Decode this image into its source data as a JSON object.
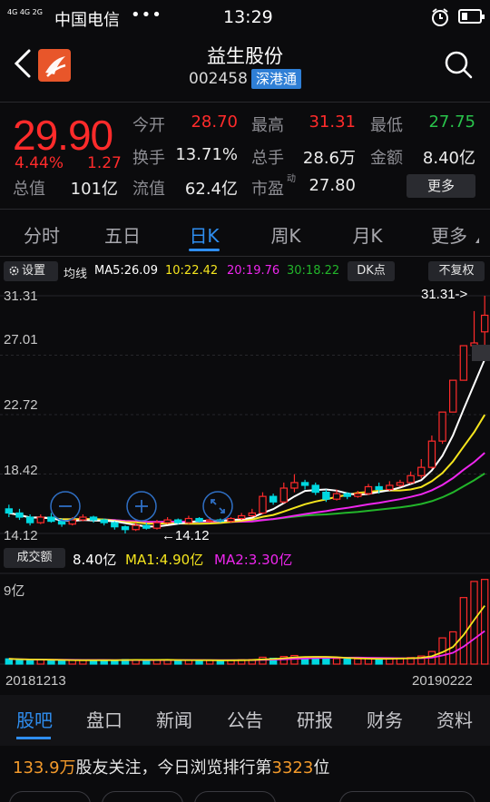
{
  "status": {
    "network": "4G 4G 2G",
    "carrier": "中国电信",
    "dots": "•••",
    "time": "13:29"
  },
  "header": {
    "title": "益生股份",
    "code": "002458",
    "tag": "深港通"
  },
  "quote": {
    "price": "29.90",
    "change_pct": "4.44%",
    "change": "1.27",
    "open_label": "今开",
    "open": "28.70",
    "high_label": "最高",
    "high": "31.31",
    "low_label": "最低",
    "low": "27.75",
    "turnover_label": "换手",
    "turnover": "13.71%",
    "volume_label": "总手",
    "volume": "28.6万",
    "amount_label": "金额",
    "amount": "8.40亿",
    "total_cap_label": "总值",
    "total_cap": "101亿",
    "float_cap_label": "流值",
    "float_cap": "62.4亿",
    "pe_label": "市盈",
    "pe_sup": "动",
    "pe": "27.80",
    "more_label": "更多"
  },
  "period_tabs": [
    "分时",
    "五日",
    "日K",
    "周K",
    "月K",
    "更多"
  ],
  "ma_bar": {
    "settings_label": "设置",
    "ma_label": "均线",
    "ma5": "MA5:26.09",
    "ma10": "10:22.42",
    "ma20": "20:19.76",
    "ma30": "30:18.22",
    "dk_label": "DK点",
    "adjust_label": "不复权"
  },
  "chart": {
    "y_labels": [
      "31.31",
      "27.01",
      "22.72",
      "18.42",
      "14.12"
    ],
    "high_marker": "31.31->",
    "low_marker": "←14.12"
  },
  "colors": {
    "up": "#ff2b2b",
    "down": "#00d8e0",
    "ma5": "#ffffff",
    "ma10": "#f5e51e",
    "ma20": "#ee26ee",
    "ma30": "#22b52a",
    "accent": "#2f8ef0"
  },
  "chart_data": {
    "type": "candlestick",
    "ylim": [
      14.12,
      31.31
    ],
    "x_start": "20181213",
    "x_end": "20190222",
    "ma5_last": 26.09,
    "ma10_last": 22.42,
    "ma20_last": 19.76,
    "ma30_last": 18.22,
    "candles": [
      [
        15.9,
        15.6,
        16.2,
        15.3
      ],
      [
        15.6,
        15.3,
        15.9,
        15.1
      ],
      [
        15.3,
        14.9,
        15.5,
        14.7
      ],
      [
        14.9,
        15.3,
        15.5,
        14.8
      ],
      [
        15.3,
        15.0,
        15.6,
        14.9
      ],
      [
        15.0,
        14.8,
        15.2,
        14.6
      ],
      [
        14.8,
        15.1,
        15.3,
        14.7
      ],
      [
        15.1,
        15.3,
        15.5,
        15.0
      ],
      [
        15.3,
        15.1,
        15.4,
        14.9
      ],
      [
        15.1,
        14.9,
        15.2,
        14.7
      ],
      [
        14.9,
        14.6,
        15.0,
        14.4
      ],
      [
        14.6,
        14.4,
        14.7,
        14.12
      ],
      [
        14.4,
        14.7,
        14.9,
        14.3
      ],
      [
        14.7,
        14.5,
        14.9,
        14.4
      ],
      [
        14.5,
        14.9,
        15.1,
        14.4
      ],
      [
        14.9,
        15.1,
        15.3,
        14.8
      ],
      [
        15.1,
        14.9,
        15.2,
        14.8
      ],
      [
        14.9,
        15.2,
        15.4,
        14.8
      ],
      [
        15.2,
        15.0,
        15.3,
        14.9
      ],
      [
        15.0,
        15.1,
        15.3,
        14.9
      ],
      [
        15.1,
        15.0,
        15.2,
        14.9
      ],
      [
        15.0,
        15.2,
        15.3,
        14.9
      ],
      [
        15.2,
        15.4,
        15.6,
        15.1
      ],
      [
        15.4,
        15.6,
        15.9,
        15.3
      ],
      [
        15.6,
        16.8,
        17.1,
        15.5
      ],
      [
        16.8,
        16.4,
        17.0,
        16.2
      ],
      [
        16.4,
        17.4,
        17.8,
        16.3
      ],
      [
        17.4,
        17.8,
        18.4,
        17.1
      ],
      [
        17.8,
        17.6,
        18.0,
        17.3
      ],
      [
        17.6,
        17.1,
        17.8,
        16.9
      ],
      [
        17.1,
        16.6,
        17.3,
        16.4
      ],
      [
        16.6,
        17.0,
        17.3,
        16.5
      ],
      [
        17.0,
        16.8,
        17.1,
        16.6
      ],
      [
        16.8,
        17.0,
        17.2,
        16.7
      ],
      [
        17.0,
        17.5,
        17.7,
        16.9
      ],
      [
        17.5,
        17.3,
        17.8,
        17.0
      ],
      [
        17.3,
        17.6,
        17.9,
        17.2
      ],
      [
        17.6,
        17.8,
        18.0,
        17.5
      ],
      [
        17.8,
        18.3,
        18.6,
        17.7
      ],
      [
        18.3,
        18.9,
        19.5,
        18.1
      ],
      [
        18.9,
        20.8,
        21.2,
        18.8
      ],
      [
        20.8,
        22.9,
        22.9,
        20.6
      ],
      [
        22.9,
        25.2,
        25.2,
        22.9
      ],
      [
        25.2,
        27.7,
        27.7,
        25.2
      ],
      [
        27.7,
        27.9,
        30.2,
        27.0
      ],
      [
        28.7,
        29.9,
        31.31,
        27.75
      ]
    ],
    "volumes": [
      0.52,
      0.45,
      0.4,
      0.42,
      0.38,
      0.4,
      0.37,
      0.36,
      0.42,
      0.4,
      0.38,
      0.45,
      0.44,
      0.4,
      0.39,
      0.42,
      0.38,
      0.4,
      0.37,
      0.36,
      0.38,
      0.4,
      0.43,
      0.45,
      0.68,
      0.58,
      0.75,
      0.85,
      0.7,
      0.72,
      0.6,
      0.55,
      0.5,
      0.52,
      0.55,
      0.5,
      0.58,
      0.6,
      0.65,
      0.8,
      1.25,
      2.6,
      3.2,
      6.6,
      8.2,
      8.4
    ],
    "vol_unit": "亿",
    "vol_max_label": "9亿"
  },
  "volume_bar": {
    "label": "成交额",
    "value": "8.40亿",
    "ma1": "MA1:4.90亿",
    "ma2": "MA2:3.30亿"
  },
  "dates": {
    "start": "20181213",
    "end": "20190222"
  },
  "bottom_tabs": [
    "股吧",
    "盘口",
    "新闻",
    "公告",
    "研报",
    "财务",
    "资料"
  ],
  "follow": {
    "count": "133.9万",
    "text_a": "股友关注，今日浏览排行第",
    "rank": "3323",
    "text_b": "位"
  }
}
